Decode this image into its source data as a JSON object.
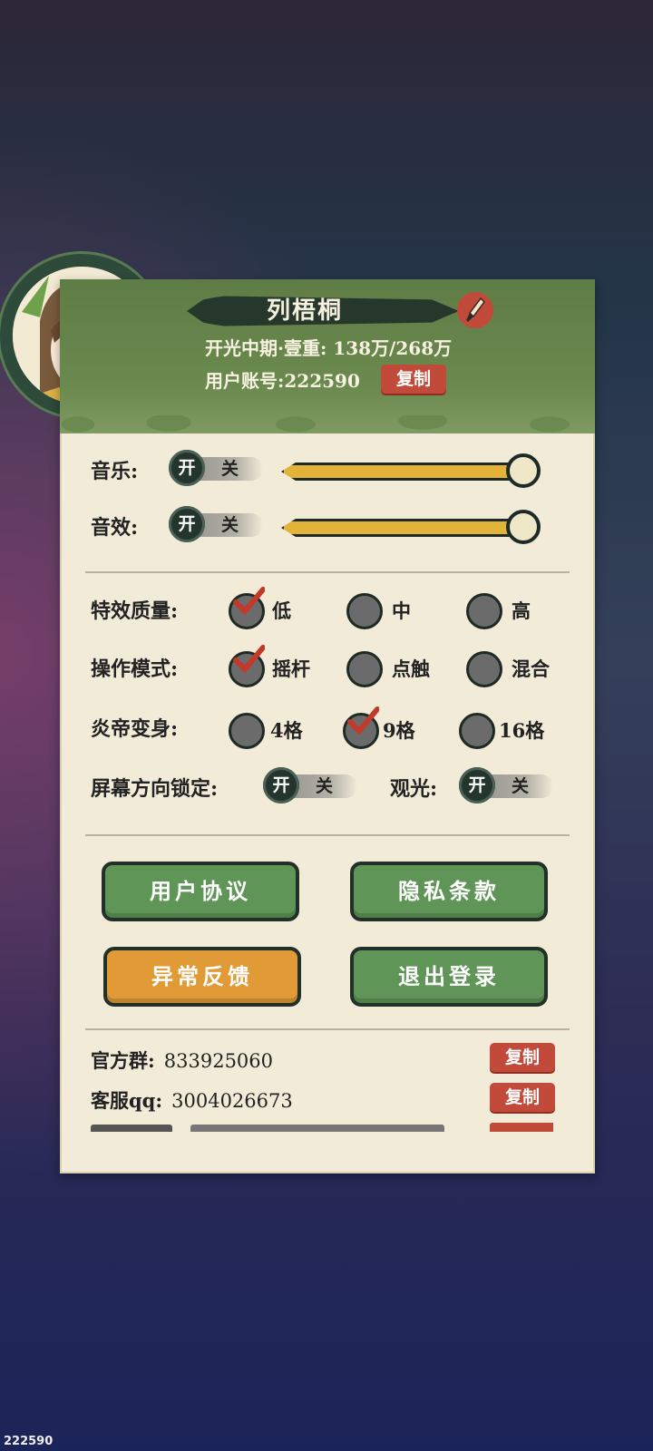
{
  "player": {
    "name": "列梧桐",
    "realm_line": "开光中期·壹重: 138万/268万",
    "account_line": "用户账号:222590",
    "copy_label": "复制"
  },
  "audio": {
    "music_label": "音乐:",
    "sfx_label": "音效:",
    "on": "开",
    "off": "关",
    "music_level": 1.0,
    "sfx_level": 1.0
  },
  "settings": {
    "effects_label": "特效质量:",
    "effects_options": [
      "低",
      "中",
      "高"
    ],
    "effects_selected": "低",
    "control_label": "操作模式:",
    "control_options": [
      "摇杆",
      "点触",
      "混合"
    ],
    "control_selected": "摇杆",
    "transform_label": "炎帝变身:",
    "transform_options": [
      "4格",
      "9格",
      "16格"
    ],
    "transform_selected": "9格",
    "orientation_label": "屏幕方向锁定:",
    "sightseeing_label": "观光:",
    "on": "开",
    "off": "关"
  },
  "buttons": {
    "agreement": "用户协议",
    "privacy": "隐私条款",
    "feedback": "异常反馈",
    "logout": "退出登录"
  },
  "contacts": {
    "group_label": "官方群:",
    "group_value": "833925060",
    "service_label": "客服qq:",
    "service_value": "3004026673",
    "copy_label": "复制"
  },
  "footer": {
    "user_id": "222590"
  },
  "colors": {
    "header_green": "#6b8a4f",
    "accent_red": "#c24a3a",
    "button_green": "#5f9556",
    "button_orange": "#e09a36",
    "slider_yellow": "#e2b338"
  }
}
